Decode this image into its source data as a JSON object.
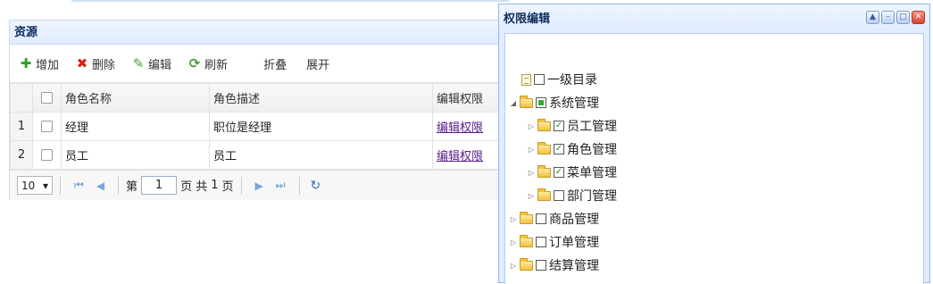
{
  "grid_panel": {
    "title": "资源",
    "toolbar": {
      "add": "增加",
      "delete": "删除",
      "edit": "编辑",
      "refresh": "刷新",
      "collapse": "折叠",
      "expand": "展开"
    },
    "columns": [
      "角色名称",
      "角色描述",
      "编辑权限"
    ],
    "rows": [
      {
        "num": "1",
        "name": "经理",
        "desc": "职位是经理",
        "action": "编辑权限"
      },
      {
        "num": "2",
        "name": "员工",
        "desc": "员工",
        "action": "编辑权限"
      }
    ],
    "pager": {
      "page_size": "10",
      "page_prefix": "第",
      "page_value": "1",
      "page_mid": "页 共",
      "total_pages": "1",
      "page_suffix": "页"
    }
  },
  "perm_window": {
    "title": "权限编辑",
    "tree": [
      {
        "label": "一级目录",
        "checked": "unchecked"
      },
      {
        "label": "系统管理",
        "checked": "partial"
      },
      {
        "label": "员工管理",
        "checked": "checked"
      },
      {
        "label": "角色管理",
        "checked": "checked"
      },
      {
        "label": "菜单管理",
        "checked": "checked"
      },
      {
        "label": "部门管理",
        "checked": "unchecked"
      },
      {
        "label": "商品管理",
        "checked": "unchecked"
      },
      {
        "label": "订单管理",
        "checked": "unchecked"
      },
      {
        "label": "结算管理",
        "checked": "unchecked"
      }
    ]
  },
  "colors": {
    "panel_header": "#e0ecff",
    "border": "#95b8e7",
    "link": "#551a8b",
    "close_button": "#d9432c"
  }
}
